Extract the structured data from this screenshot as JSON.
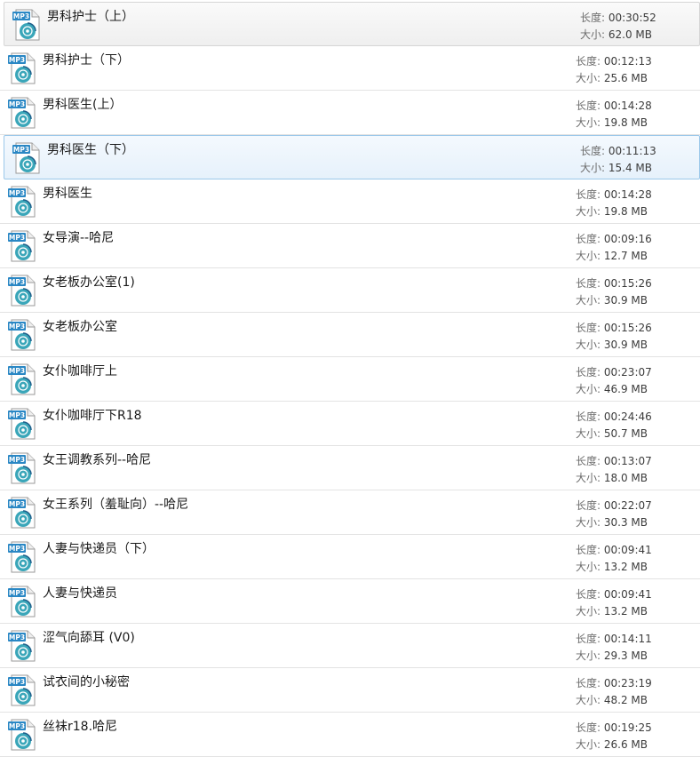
{
  "labels": {
    "length": "长度: ",
    "size": "大小: "
  },
  "icon": {
    "name": "mp3-file-icon",
    "badge_text": "MP3",
    "badge_color": "#2a87c4",
    "disc_color": "#3aa6b9"
  },
  "files": [
    {
      "name": "男科护士（上）",
      "length": "00:30:52",
      "size": "62.0 MB",
      "state": "hover"
    },
    {
      "name": "男科护士（下）",
      "length": "00:12:13",
      "size": "25.6 MB",
      "state": ""
    },
    {
      "name": "男科医生(上）",
      "length": "00:14:28",
      "size": "19.8 MB",
      "state": ""
    },
    {
      "name": "男科医生（下）",
      "length": "00:11:13",
      "size": "15.4 MB",
      "state": "selected"
    },
    {
      "name": "男科医生",
      "length": "00:14:28",
      "size": "19.8 MB",
      "state": ""
    },
    {
      "name": "女导演--哈尼",
      "length": "00:09:16",
      "size": "12.7 MB",
      "state": ""
    },
    {
      "name": "女老板办公室(1)",
      "length": "00:15:26",
      "size": "30.9 MB",
      "state": ""
    },
    {
      "name": "女老板办公室",
      "length": "00:15:26",
      "size": "30.9 MB",
      "state": ""
    },
    {
      "name": "女仆咖啡厅上",
      "length": "00:23:07",
      "size": "46.9 MB",
      "state": ""
    },
    {
      "name": "女仆咖啡厅下R18",
      "length": "00:24:46",
      "size": "50.7 MB",
      "state": ""
    },
    {
      "name": "女王调教系列--哈尼",
      "length": "00:13:07",
      "size": "18.0 MB",
      "state": ""
    },
    {
      "name": "女王系列（羞耻向）--哈尼",
      "length": "00:22:07",
      "size": "30.3 MB",
      "state": ""
    },
    {
      "name": "人妻与快递员（下）",
      "length": "00:09:41",
      "size": "13.2 MB",
      "state": ""
    },
    {
      "name": "人妻与快递员",
      "length": "00:09:41",
      "size": "13.2 MB",
      "state": ""
    },
    {
      "name": "涩气向舔耳 (V0)",
      "length": "00:14:11",
      "size": "29.3 MB",
      "state": ""
    },
    {
      "name": "试衣间的小秘密",
      "length": "00:23:19",
      "size": "48.2 MB",
      "state": ""
    },
    {
      "name": "丝袜r18.哈尼",
      "length": "00:19:25",
      "size": "26.6 MB",
      "state": ""
    }
  ]
}
